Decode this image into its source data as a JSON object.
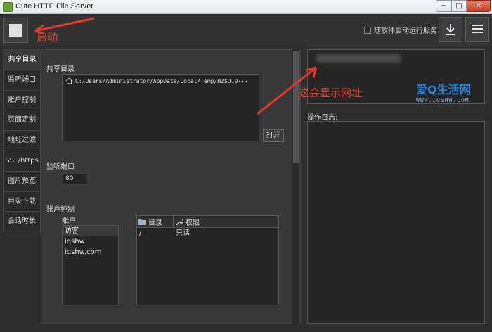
{
  "window": {
    "title": "Cute HTTP File Server",
    "buttons": {
      "minimize": "−",
      "maximize": "□",
      "close": "✕"
    }
  },
  "toolbar": {
    "start_icon": "stop-square-icon",
    "autorun_label": "随软件启动运行服务",
    "autorun_checked": false,
    "download_icon": "download-icon",
    "menu_icon": "hamburger-menu-icon"
  },
  "sidebar": {
    "items": [
      {
        "label": "共享目录",
        "active": true
      },
      {
        "label": "监听端口",
        "active": false
      },
      {
        "label": "账户控制",
        "active": false
      },
      {
        "label": "页面定制",
        "active": false
      },
      {
        "label": "地址过滤",
        "active": false
      },
      {
        "label": "SSL/https",
        "active": false
      },
      {
        "label": "图片预览",
        "active": false
      },
      {
        "label": "目录下载",
        "active": false
      },
      {
        "label": "会话时长",
        "active": false
      }
    ]
  },
  "share": {
    "section_label": "共享目录",
    "path": "C:/Users/Administrator/AppData/Local/Temp/HZ$D.0···",
    "open_button": "打开"
  },
  "port": {
    "section_label": "监听端口",
    "value": "80"
  },
  "accounts": {
    "section_label": "账户控制",
    "list_label": "账户",
    "items": [
      "访客",
      "iqshw",
      "iqshw.com"
    ],
    "selected_index": 0,
    "table": {
      "col_dir": "目录",
      "col_perm": "权限",
      "rows": [
        {
          "dir": "/",
          "perm": "只读"
        }
      ]
    }
  },
  "log": {
    "label": "操作日志:"
  },
  "annotations": {
    "start": "启动",
    "url": "这会显示网址",
    "color": "#e23a2a"
  },
  "watermark": {
    "title": "爱Q生活网",
    "sub": "WWW.IQSHW.COM"
  }
}
